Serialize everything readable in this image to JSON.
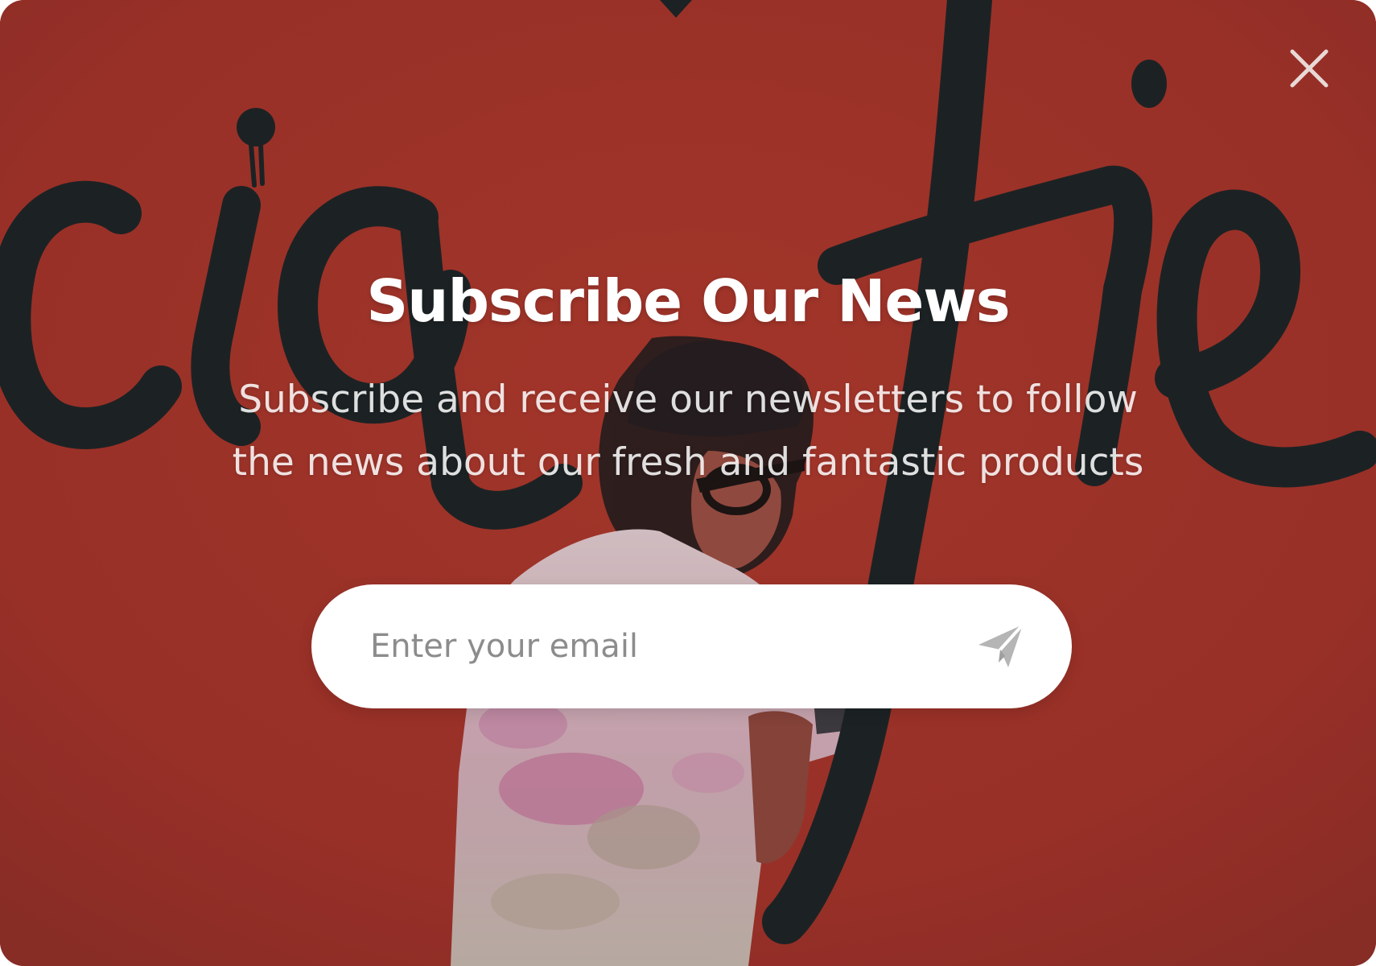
{
  "popup": {
    "title": "Subscribe Our News",
    "subtitle_line1": "Subscribe and receive our newsletters to follow",
    "subtitle_line2": "the news about our fresh and fantastic products",
    "email_placeholder": "Enter your email",
    "email_value": "",
    "close_icon": "close-icon",
    "send_icon": "paper-plane-icon"
  },
  "colors": {
    "background": "#a8372d",
    "wall_lettering": "#1b2527",
    "title_text": "#ffffff",
    "input_background": "#ffffff",
    "placeholder_text": "#8c8c8c",
    "icon_gray": "#b5b5b5"
  }
}
